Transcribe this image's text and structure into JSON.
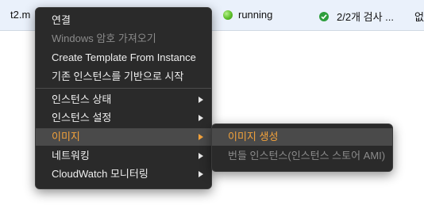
{
  "row": {
    "name": "t2.m",
    "state": "running",
    "status_check": "2/2개 검사 ...",
    "extra": "없"
  },
  "colors": {
    "menu_bg": "#2a2a2a",
    "highlight_text": "#f3a23b",
    "running_dot": "#5cbf2a",
    "check_ok": "#2e9e3c"
  },
  "menu": {
    "items": [
      {
        "label": "연결"
      },
      {
        "label": "Windows 암호 가져오기"
      },
      {
        "label": "Create Template From Instance"
      },
      {
        "label": "기존 인스턴스를 기반으로 시작"
      },
      {
        "label": "인스턴스 상태"
      },
      {
        "label": "인스턴스 설정"
      },
      {
        "label": "이미지"
      },
      {
        "label": "네트워킹"
      },
      {
        "label": "CloudWatch 모니터링"
      }
    ]
  },
  "submenu": {
    "items": [
      {
        "label": "이미지 생성"
      },
      {
        "label": "번들 인스턴스(인스턴스 스토어 AMI)"
      }
    ]
  }
}
